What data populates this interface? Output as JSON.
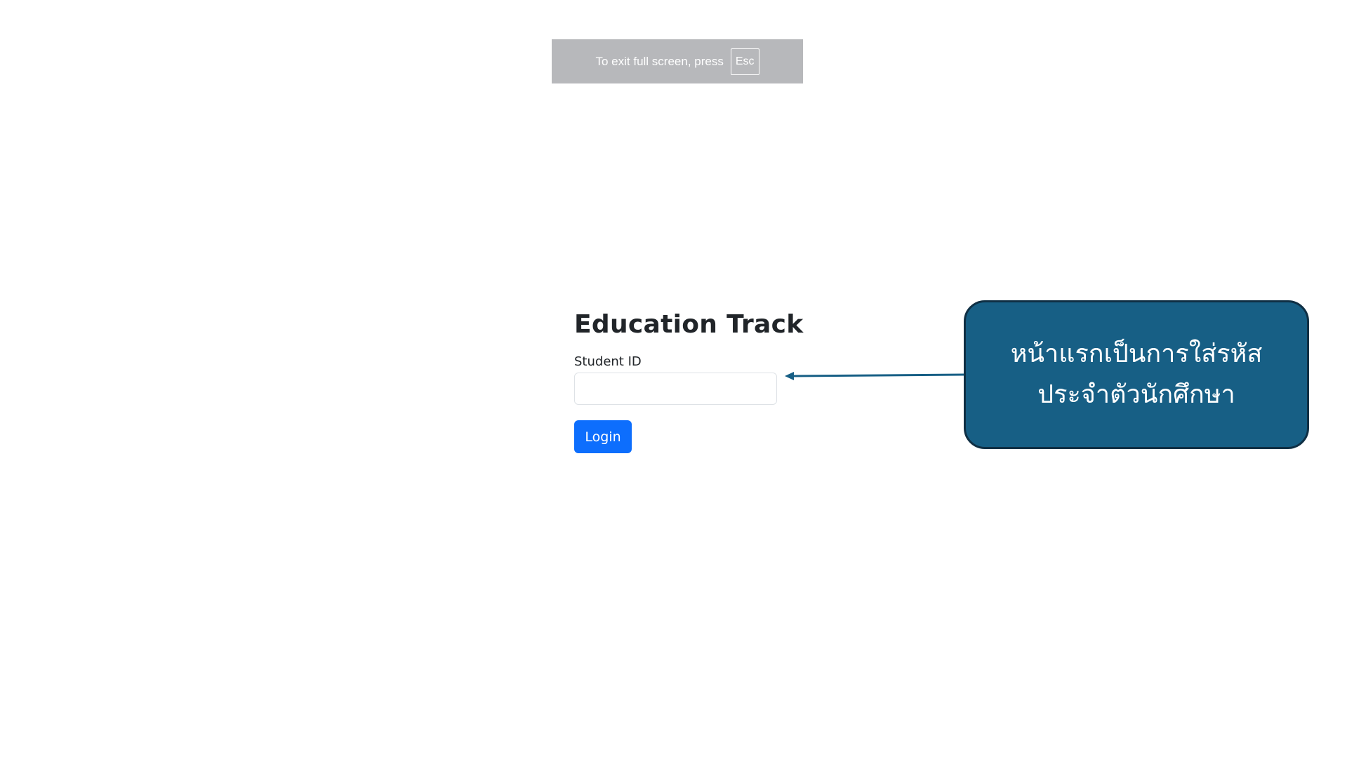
{
  "fullscreen_notice": {
    "text": "To exit full screen, press",
    "key": "Esc"
  },
  "login": {
    "title": "Education Track",
    "student_id_label": "Student ID",
    "student_id_value": "",
    "login_button": "Login"
  },
  "annotation": {
    "line1": "หน้าแรกเป็นการใส่รหัส",
    "line2": "ประจำตัวนักศึกษา"
  },
  "colors": {
    "primary_button": "#0d6efd",
    "callout_fill": "#175f85",
    "callout_border": "#0f2f44",
    "arrow": "#175f85",
    "banner": "#b7b8bb"
  }
}
